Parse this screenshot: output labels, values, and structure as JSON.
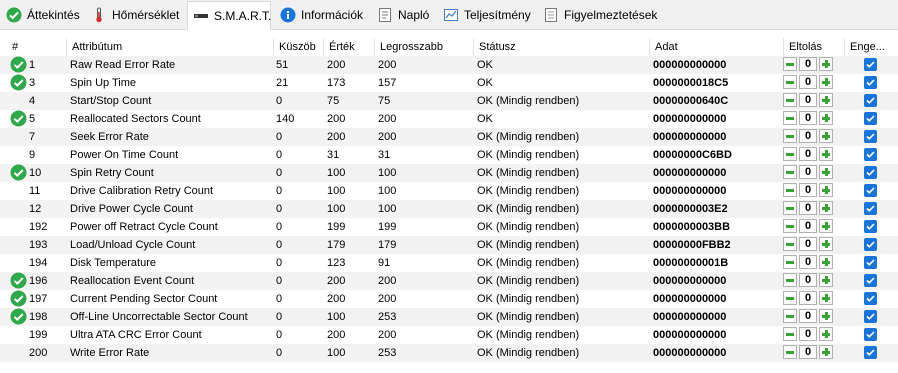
{
  "tabs": [
    {
      "label": "Áttekintés",
      "icon": "green-check-icon",
      "active": false
    },
    {
      "label": "Hőmérséklet",
      "icon": "thermometer-icon",
      "active": false
    },
    {
      "label": "S.M.A.R.T.",
      "icon": "smart-drive-icon",
      "active": true
    },
    {
      "label": "Információk",
      "icon": "info-icon",
      "active": false
    },
    {
      "label": "Napló",
      "icon": "log-icon",
      "active": false
    },
    {
      "label": "Teljesítmény",
      "icon": "performance-chart-icon",
      "active": false
    },
    {
      "label": "Figyelmeztetések",
      "icon": "alerts-icon",
      "active": false
    }
  ],
  "table": {
    "headers": [
      "#",
      "Attribútum",
      "Küszöb",
      "Érték",
      "Legrosszabb",
      "Státusz",
      "Adat",
      "Eltolás",
      "Enge..."
    ],
    "rows": [
      {
        "icon": true,
        "id": "1",
        "name": "Raw Read Error Rate",
        "threshold": "51",
        "value": "200",
        "worst": "200",
        "status": "OK",
        "data": "000000000000",
        "offset": "0"
      },
      {
        "icon": true,
        "id": "3",
        "name": "Spin Up Time",
        "threshold": "21",
        "value": "173",
        "worst": "157",
        "status": "OK",
        "data": "0000000018C5",
        "offset": "0"
      },
      {
        "icon": false,
        "id": "4",
        "name": "Start/Stop Count",
        "threshold": "0",
        "value": "75",
        "worst": "75",
        "status": "OK (Mindig rendben)",
        "data": "00000000640C",
        "offset": "0"
      },
      {
        "icon": true,
        "id": "5",
        "name": "Reallocated Sectors Count",
        "threshold": "140",
        "value": "200",
        "worst": "200",
        "status": "OK",
        "data": "000000000000",
        "offset": "0"
      },
      {
        "icon": false,
        "id": "7",
        "name": "Seek Error Rate",
        "threshold": "0",
        "value": "200",
        "worst": "200",
        "status": "OK (Mindig rendben)",
        "data": "000000000000",
        "offset": "0"
      },
      {
        "icon": false,
        "id": "9",
        "name": "Power On Time Count",
        "threshold": "0",
        "value": "31",
        "worst": "31",
        "status": "OK (Mindig rendben)",
        "data": "00000000C6BD",
        "offset": "0"
      },
      {
        "icon": true,
        "id": "10",
        "name": "Spin Retry Count",
        "threshold": "0",
        "value": "100",
        "worst": "100",
        "status": "OK (Mindig rendben)",
        "data": "000000000000",
        "offset": "0"
      },
      {
        "icon": false,
        "id": "11",
        "name": "Drive Calibration Retry Count",
        "threshold": "0",
        "value": "100",
        "worst": "100",
        "status": "OK (Mindig rendben)",
        "data": "000000000000",
        "offset": "0"
      },
      {
        "icon": false,
        "id": "12",
        "name": "Drive Power Cycle Count",
        "threshold": "0",
        "value": "100",
        "worst": "100",
        "status": "OK (Mindig rendben)",
        "data": "0000000003E2",
        "offset": "0"
      },
      {
        "icon": false,
        "id": "192",
        "name": "Power off Retract Cycle Count",
        "threshold": "0",
        "value": "199",
        "worst": "199",
        "status": "OK (Mindig rendben)",
        "data": "0000000003BB",
        "offset": "0"
      },
      {
        "icon": false,
        "id": "193",
        "name": "Load/Unload Cycle Count",
        "threshold": "0",
        "value": "179",
        "worst": "179",
        "status": "OK (Mindig rendben)",
        "data": "00000000FBB2",
        "offset": "0"
      },
      {
        "icon": false,
        "id": "194",
        "name": "Disk Temperature",
        "threshold": "0",
        "value": "123",
        "worst": "91",
        "status": "OK (Mindig rendben)",
        "data": "00000000001B",
        "offset": "0"
      },
      {
        "icon": true,
        "id": "196",
        "name": "Reallocation Event Count",
        "threshold": "0",
        "value": "200",
        "worst": "200",
        "status": "OK (Mindig rendben)",
        "data": "000000000000",
        "offset": "0"
      },
      {
        "icon": true,
        "id": "197",
        "name": "Current Pending Sector Count",
        "threshold": "0",
        "value": "200",
        "worst": "200",
        "status": "OK (Mindig rendben)",
        "data": "000000000000",
        "offset": "0"
      },
      {
        "icon": true,
        "id": "198",
        "name": "Off-Line Uncorrectable Sector Count",
        "threshold": "0",
        "value": "100",
        "worst": "253",
        "status": "OK (Mindig rendben)",
        "data": "000000000000",
        "offset": "0"
      },
      {
        "icon": false,
        "id": "199",
        "name": "Ultra ATA CRC Error Count",
        "threshold": "0",
        "value": "200",
        "worst": "200",
        "status": "OK (Mindig rendben)",
        "data": "000000000000",
        "offset": "0"
      },
      {
        "icon": false,
        "id": "200",
        "name": "Write Error Rate",
        "threshold": "0",
        "value": "100",
        "worst": "253",
        "status": "OK (Mindig rendben)",
        "data": "000000000000",
        "offset": "0"
      }
    ]
  },
  "colors": {
    "ok_green": "#2ea84a",
    "stepper_green": "#3aa235",
    "checkbox_blue": "#1a73d9",
    "alt_row": "#f2f2f2"
  }
}
